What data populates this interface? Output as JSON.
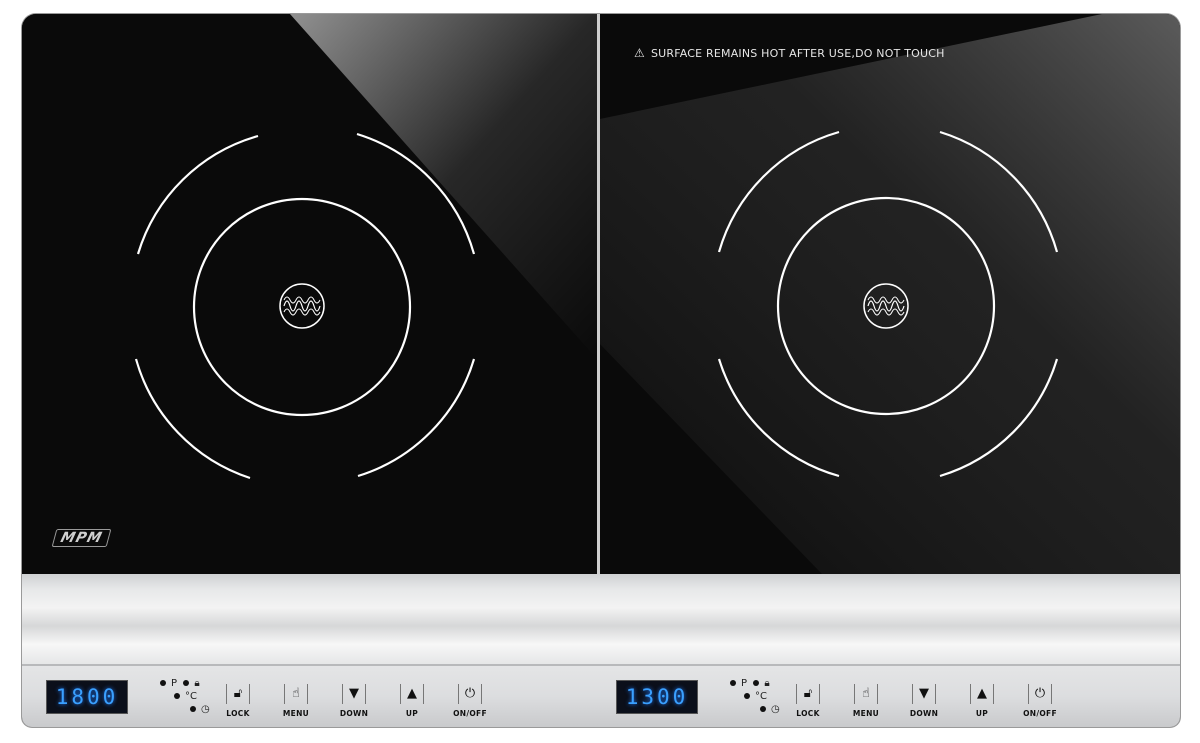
{
  "warning": {
    "icon": "warning-triangle-icon",
    "text": "SURFACE REMAINS HOT AFTER USE,DO NOT TOUCH"
  },
  "brand": {
    "logo_text": "MPM"
  },
  "zones": [
    {
      "display": "1800",
      "indicators": {
        "p": "P",
        "celsius": "°C"
      },
      "buttons": [
        {
          "label": "LOCK",
          "icon": "lock-icon"
        },
        {
          "label": "MENU",
          "icon": "hand-icon"
        },
        {
          "label": "DOWN",
          "icon": "triangle-down-icon"
        },
        {
          "label": "UP",
          "icon": "triangle-up-icon"
        },
        {
          "label": "ON/OFF",
          "icon": "power-icon"
        }
      ]
    },
    {
      "display": "1300",
      "indicators": {
        "p": "P",
        "celsius": "°C"
      },
      "buttons": [
        {
          "label": "LOCK",
          "icon": "lock-icon"
        },
        {
          "label": "MENU",
          "icon": "hand-icon"
        },
        {
          "label": "DOWN",
          "icon": "triangle-down-icon"
        },
        {
          "label": "UP",
          "icon": "triangle-up-icon"
        },
        {
          "label": "ON/OFF",
          "icon": "power-icon"
        }
      ]
    }
  ],
  "colors": {
    "glass": "#111111",
    "display_digits": "#3aa0ff",
    "panel": "#e4e5e6"
  }
}
